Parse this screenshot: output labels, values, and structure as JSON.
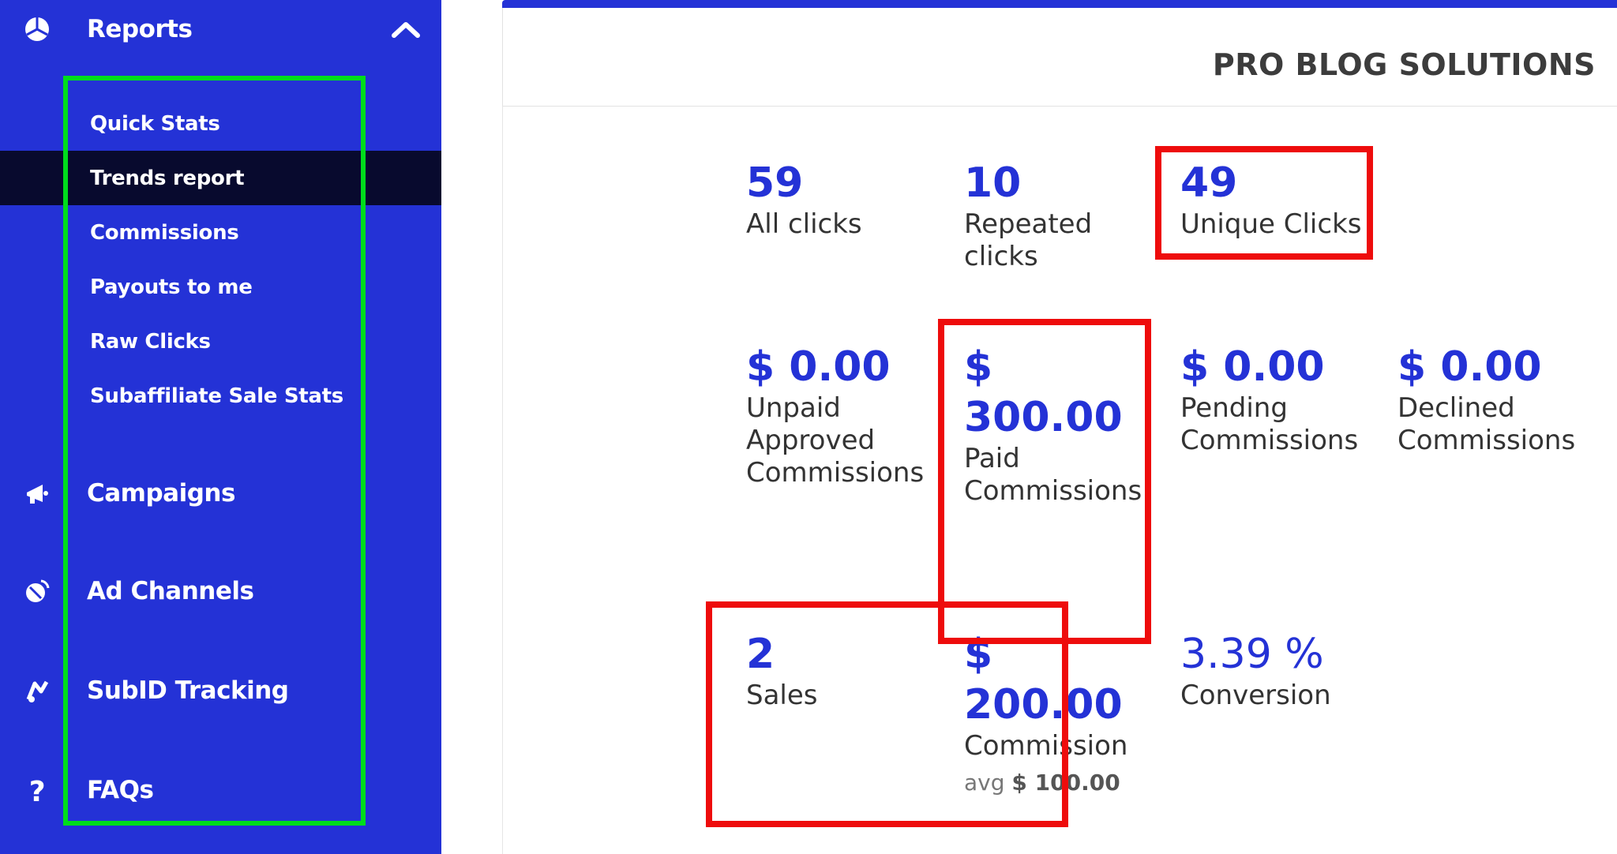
{
  "sidebar": {
    "reports": {
      "label": "Reports",
      "icon": "pie-chart-icon",
      "toggle_icon": "chevron-up-icon"
    },
    "sub_items": [
      {
        "label": "Quick Stats"
      },
      {
        "label": "Trends report",
        "active": true
      },
      {
        "label": "Commissions"
      },
      {
        "label": "Payouts to me"
      },
      {
        "label": "Raw Clicks"
      },
      {
        "label": "Subaffiliate Sale Stats"
      }
    ],
    "main_items": [
      {
        "label": "Campaigns",
        "icon": "megaphone-icon"
      },
      {
        "label": "Ad Channels",
        "icon": "satellite-dish-icon"
      },
      {
        "label": "SubID Tracking",
        "icon": "tracking-icon"
      },
      {
        "label": "FAQs",
        "icon": "question-icon"
      }
    ]
  },
  "header": {
    "title": "PRO BLOG SOLUTIONS"
  },
  "stats": {
    "all_clicks": {
      "value": "59",
      "label": "All clicks"
    },
    "repeated_clicks": {
      "value": "10",
      "label": "Repeated clicks"
    },
    "unique_clicks": {
      "value": "49",
      "label": "Unique Clicks"
    },
    "unpaid_approved": {
      "value": "$ 0.00",
      "label": "Unpaid Approved Commissions"
    },
    "paid": {
      "value": "$ 300.00",
      "label": "Paid Commissions"
    },
    "pending": {
      "value": "$ 0.00",
      "label": "Pending Commissions"
    },
    "declined": {
      "value": "$ 0.00",
      "label": "Declined Commissions"
    },
    "sales": {
      "value": "2",
      "label": "Sales"
    },
    "commission": {
      "value": "$ 200.00",
      "label": "Commission",
      "avg_label": "avg",
      "avg_value": "$ 100.00"
    },
    "conversion": {
      "value": "3.39 %",
      "label": "Conversion"
    }
  },
  "colors": {
    "accent": "#2432d6",
    "active": "#080a2e",
    "highlight_red": "#ee0c0c",
    "highlight_green": "#00dd1c"
  }
}
